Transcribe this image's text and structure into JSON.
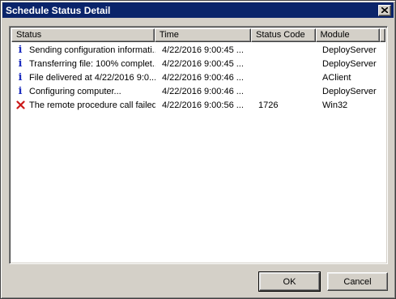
{
  "window": {
    "title": "Schedule Status Detail"
  },
  "list": {
    "columns": [
      "Status",
      "Time",
      "Status Code",
      "Module"
    ],
    "rows": [
      {
        "icon": "info-icon",
        "status": "Sending configuration informati...",
        "time": "4/22/2016 9:00:45 ...",
        "code": "",
        "module": "DeployServer"
      },
      {
        "icon": "info-icon",
        "status": "Transferring file: 100% complet...",
        "time": "4/22/2016 9:00:45 ...",
        "code": "",
        "module": "DeployServer"
      },
      {
        "icon": "info-icon",
        "status": "File delivered at 4/22/2016 9:0...",
        "time": "4/22/2016 9:00:46 ...",
        "code": "",
        "module": "AClient"
      },
      {
        "icon": "info-icon",
        "status": "Configuring computer...",
        "time": "4/22/2016 9:00:46 ...",
        "code": "",
        "module": "DeployServer"
      },
      {
        "icon": "error-icon",
        "status": "The remote procedure call failed.",
        "time": "4/22/2016 9:00:56 ...",
        "code": "1726",
        "module": "Win32"
      }
    ]
  },
  "buttons": {
    "ok": "OK",
    "cancel": "Cancel"
  },
  "colors": {
    "titlebar": "#0a246a",
    "info_icon": "#1f2fc0",
    "error_icon": "#cc1a1a"
  }
}
